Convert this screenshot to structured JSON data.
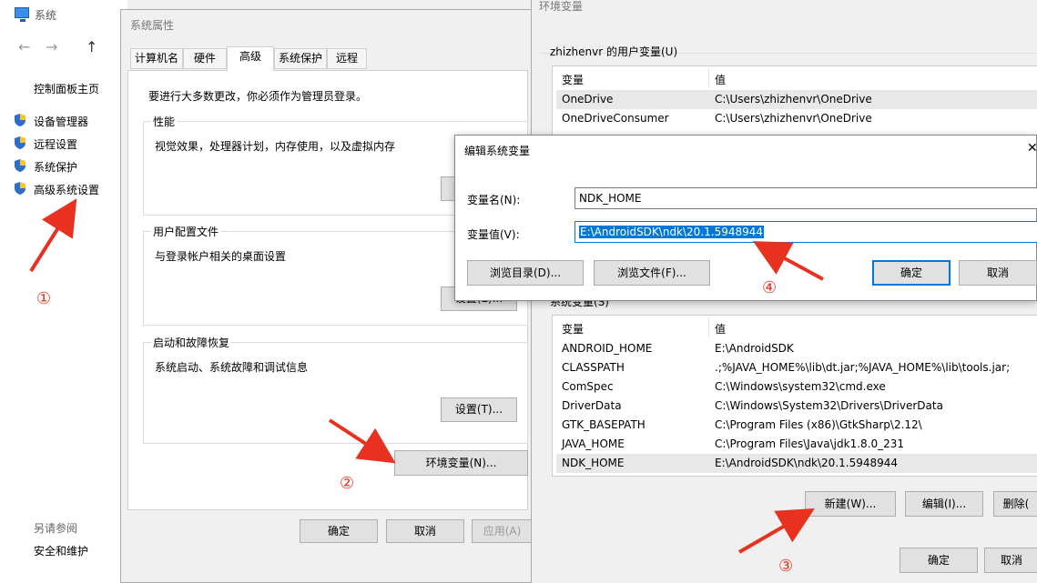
{
  "system_window": {
    "title": "系统",
    "nav": {
      "back": "←",
      "forward": "→",
      "up": "↑"
    },
    "home_link": "控制面板主页",
    "links": [
      {
        "label": "设备管理器"
      },
      {
        "label": "远程设置"
      },
      {
        "label": "系统保护"
      },
      {
        "label": "高级系统设置"
      }
    ],
    "see_also": "另请参阅",
    "security": "安全和维护"
  },
  "system_properties": {
    "title": "系统属性",
    "tabs": [
      "计算机名",
      "硬件",
      "高级",
      "系统保护",
      "远程"
    ],
    "active_tab": "高级",
    "admin_note": "要进行大多数更改，你必须作为管理员登录。",
    "groups": [
      {
        "title": "性能",
        "desc": "视觉效果，处理器计划，内存使用，以及虚拟内存",
        "button": ""
      },
      {
        "title": "用户配置文件",
        "desc": "与登录帐户相关的桌面设置",
        "button": "设置(E)..."
      },
      {
        "title": "启动和故障恢复",
        "desc": "系统启动、系统故障和调试信息",
        "button": "设置(T)..."
      }
    ],
    "env_button": "环境变量(N)...",
    "ok": "确定",
    "cancel": "取消",
    "apply": "应用(A)"
  },
  "env_vars": {
    "title": "环境变量",
    "user_label": "zhizhenvr 的用户变量(U)",
    "col_var": "变量",
    "col_val": "值",
    "user_rows": [
      {
        "name": "OneDrive",
        "value": "C:\\Users\\zhizhenvr\\OneDrive"
      },
      {
        "name": "OneDriveConsumer",
        "value": "C:\\Users\\zhizhenvr\\OneDrive"
      }
    ],
    "system_label": "系统变量(S)",
    "system_rows": [
      {
        "name": "ANDROID_HOME",
        "value": "E:\\AndroidSDK"
      },
      {
        "name": "CLASSPATH",
        "value": ".;%JAVA_HOME%\\lib\\dt.jar;%JAVA_HOME%\\lib\\tools.jar;"
      },
      {
        "name": "ComSpec",
        "value": "C:\\Windows\\system32\\cmd.exe"
      },
      {
        "name": "DriverData",
        "value": "C:\\Windows\\System32\\Drivers\\DriverData"
      },
      {
        "name": "GTK_BASEPATH",
        "value": "C:\\Program Files (x86)\\GtkSharp\\2.12\\"
      },
      {
        "name": "JAVA_HOME",
        "value": "C:\\Program Files\\Java\\jdk1.8.0_231"
      },
      {
        "name": "NDK_HOME",
        "value": "E:\\AndroidSDK\\ndk\\20.1.5948944"
      }
    ],
    "new_button": "新建(W)...",
    "edit_button": "编辑(I)...",
    "delete_button": "删除(",
    "ok": "确定",
    "cancel": "取消"
  },
  "edit_dialog": {
    "title": "编辑系统变量",
    "close": "✕",
    "name_label": "变量名(N):",
    "name_value": "NDK_HOME",
    "value_label": "变量值(V):",
    "value_value": "E:\\AndroidSDK\\ndk\\20.1.5948944",
    "browse_dir": "浏览目录(D)...",
    "browse_file": "浏览文件(F)...",
    "ok": "确定",
    "cancel": "取消"
  },
  "annotations": [
    "①",
    "②",
    "③",
    "④"
  ],
  "colors": {
    "accent": "#0078d7",
    "annotation": "#e8321f"
  }
}
